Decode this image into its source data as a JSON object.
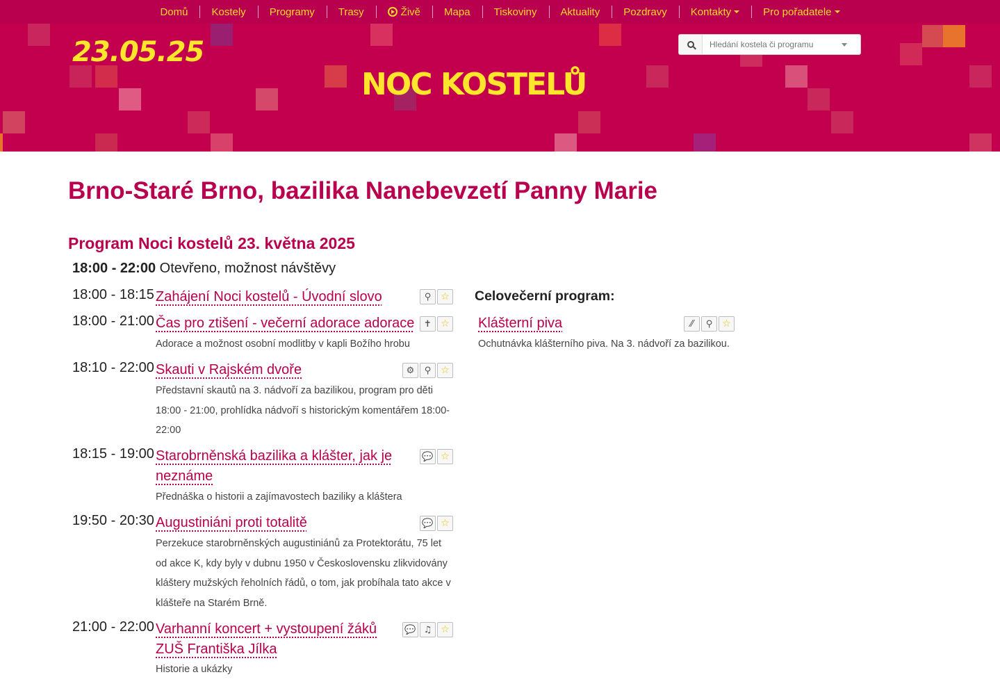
{
  "nav": {
    "items": [
      {
        "label": "Domů"
      },
      {
        "label": "Kostely"
      },
      {
        "label": "Programy"
      },
      {
        "label": "Trasy"
      },
      {
        "label": "Živě"
      },
      {
        "label": "Mapa"
      },
      {
        "label": "Tiskoviny"
      },
      {
        "label": "Aktuality"
      },
      {
        "label": "Pozdravy"
      },
      {
        "label": "Kontakty"
      },
      {
        "label": "Pro pořadatele"
      }
    ]
  },
  "header": {
    "date": "23.05.25",
    "logo": "NOC KOSTELŮ",
    "search_placeholder": "Hledání kostela či programu"
  },
  "colors": {
    "brand": "#c2004d",
    "nav": "#b8004e",
    "accent": "#ffe52b"
  },
  "page": {
    "title": "Brno-Staré Brno, bazilika Nanebevzetí Panny Marie",
    "program_title": "Program Noci kostelů 23. května 2025",
    "open_time": "18:00 - 22:00",
    "open_text": "Otevřeno, možnost návštěvy"
  },
  "program": [
    {
      "time": "18:00 - 18:15",
      "title": "Zahájení Noci kostelů - Úvodní slovo",
      "desc": "",
      "icons": [
        "people-icon",
        "star-icon"
      ]
    },
    {
      "time": "18:00 - 21:00",
      "title": "Čas pro ztišení - večerní adorace adorace",
      "desc": "Adorace a možnost osobní modlitby v kapli Božího hrobu",
      "icons": [
        "prayer-icon",
        "star-icon"
      ]
    },
    {
      "time": "18:10 - 22:00",
      "title": "Skauti v Rajském dvoře",
      "desc": "Představní skautů na 3. nádvoří za bazilikou, program pro děti 18:00 - 21:00, prohlídka nádvoří s historickým komentářem 18:00-22:00",
      "icons": [
        "search-tour-icon",
        "people-icon",
        "star-icon"
      ]
    },
    {
      "time": "18:15 - 19:00",
      "title": "Starobrněnská bazilika a klášter, jak je neznáme",
      "desc": "Přednáška o historii a zajímavostech baziliky a kláštera",
      "icons": [
        "talk-icon",
        "star-icon"
      ]
    },
    {
      "time": "19:50 - 20:30",
      "title": "Augustiniáni proti totalitě",
      "desc": "Perzekuce starobrněnských augustiniánů za Protektorátu, 75 let od akce K, kdy byly v dubnu 1950 v Československu zlikvidovány kláštery mužských řeholních řádů, o tom, jak probíhala tato akce v klášteře na Starém Brně.",
      "icons": [
        "talk-icon",
        "star-icon"
      ]
    },
    {
      "time": "21:00 - 22:00",
      "title": "Varhanní koncert + vystoupení žáků ZUŠ Františka Jílka",
      "desc": "Historie a ukázky",
      "icons": [
        "talk-icon",
        "music-icon",
        "star-icon"
      ]
    }
  ],
  "evening": {
    "heading": "Celovečerní program:",
    "title": "Klášterní piva",
    "desc": "Ochutnávka klášterního piva. Na 3. nádvoří za bazilikou.",
    "icons": [
      "refreshment-icon",
      "people-icon",
      "star-icon"
    ]
  }
}
